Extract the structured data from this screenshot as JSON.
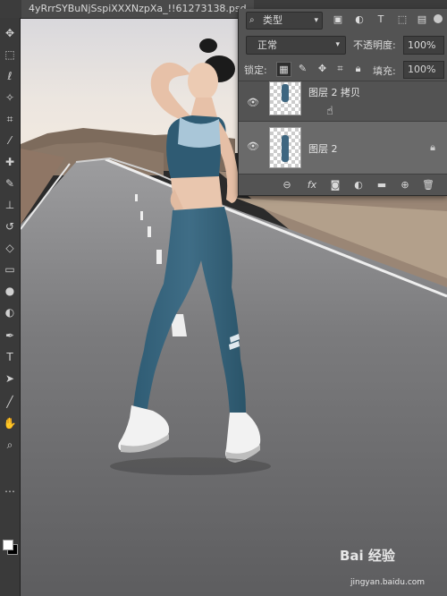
{
  "document": {
    "tab_title": "4yRrrSYBuNjSspiXXXNzpXa_!!61273138.psd"
  },
  "toolbar": {
    "tools": [
      {
        "name": "move-tool-icon",
        "glyph": "✥"
      },
      {
        "name": "marquee-tool-icon",
        "glyph": "⬚"
      },
      {
        "name": "lasso-tool-icon",
        "glyph": "ℓ"
      },
      {
        "name": "magic-wand-tool-icon",
        "glyph": "✧"
      },
      {
        "name": "crop-tool-icon",
        "glyph": "⌗"
      },
      {
        "name": "eyedropper-tool-icon",
        "glyph": "⁄"
      },
      {
        "name": "healing-brush-tool-icon",
        "glyph": "✚"
      },
      {
        "name": "brush-tool-icon",
        "glyph": "✎"
      },
      {
        "name": "clone-stamp-tool-icon",
        "glyph": "⊥"
      },
      {
        "name": "history-brush-tool-icon",
        "glyph": "↺"
      },
      {
        "name": "eraser-tool-icon",
        "glyph": "◇"
      },
      {
        "name": "gradient-tool-icon",
        "glyph": "▭"
      },
      {
        "name": "blur-tool-icon",
        "glyph": "●"
      },
      {
        "name": "dodge-tool-icon",
        "glyph": "◐"
      },
      {
        "name": "pen-tool-icon",
        "glyph": "✒"
      },
      {
        "name": "type-tool-icon",
        "glyph": "T"
      },
      {
        "name": "path-selection-tool-icon",
        "glyph": "➤"
      },
      {
        "name": "line-tool-icon",
        "glyph": "╱"
      },
      {
        "name": "hand-tool-icon",
        "glyph": "✋"
      },
      {
        "name": "zoom-tool-icon",
        "glyph": "⌕"
      },
      {
        "name": "more-tools-icon",
        "glyph": "⋯"
      }
    ]
  },
  "layers_panel": {
    "kind_label": "类型",
    "blend_mode": "正常",
    "opacity_label": "不透明度:",
    "opacity_value": "100%",
    "lock_label": "锁定:",
    "fill_label": "填充:",
    "fill_value": "100%",
    "layers": [
      {
        "name": "图层 2 拷贝",
        "visible": true,
        "selected": false,
        "locked": false
      },
      {
        "name": "图层 2",
        "visible": true,
        "selected": true,
        "locked": true
      }
    ]
  },
  "watermark": {
    "text": "Bai 经验",
    "url": "jingyan.baidu.com"
  }
}
